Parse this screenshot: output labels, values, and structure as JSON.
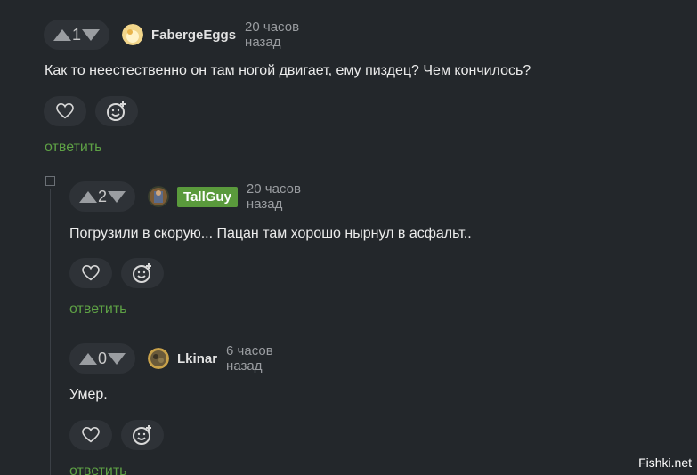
{
  "top_cut_text": "",
  "comments": [
    {
      "rating": "1",
      "author": "FabergeEggs",
      "time": "20 часов назад",
      "text": "Как то неестественно он там ногой двигает, ему пиздец? Чем кончилось?",
      "reply_label": "ответить",
      "author_badge": false
    },
    {
      "rating": "2",
      "author": "TallGuy",
      "time": "20 часов назад",
      "text": "Погрузили в скорую... Пацан там хорошо нырнул в асфальт..",
      "reply_label": "ответить",
      "author_badge": true
    },
    {
      "rating": "0",
      "author": "Lkinar",
      "time": "6 часов назад",
      "text": "Умер.",
      "reply_label": "ответить",
      "author_badge": false
    }
  ],
  "watermark": "Fishki.net",
  "colors": {
    "background": "#23272b",
    "pill": "#2e3237",
    "reply_green": "#5ea145",
    "badge_green": "#5a9a3c"
  },
  "icons": [
    "upvote-icon",
    "downvote-icon",
    "heart-icon",
    "emoji-add-icon",
    "collapse-icon"
  ]
}
